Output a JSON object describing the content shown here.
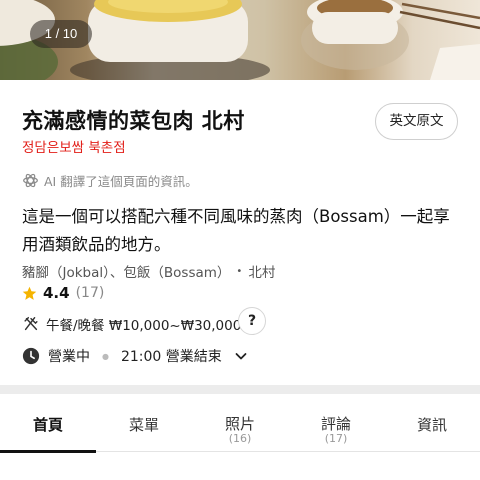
{
  "hero": {
    "photo_counter": "1 / 10"
  },
  "restaurant": {
    "name": "充滿感情的菜包肉 北村",
    "original_name": "정담은보쌈 북촌점",
    "original_language_button": "英文原文",
    "ai_note": "AI 翻譯了這個頁面的資訊。",
    "description": "這是一個可以搭配六種不同風味的蒸肉（Bossam）一起享用酒類飲品的地方。",
    "categories": "豬腳（Jokbal）、包飯（Bossam）",
    "area": "北村",
    "rating": "4.4",
    "review_count": "(17)",
    "price": "午餐/晚餐 ₩10,000~₩30,000",
    "help_label": "?",
    "status": "營業中",
    "closing": "21:00 營業結束"
  },
  "tabs": [
    {
      "label": "首頁",
      "count": "",
      "active": true
    },
    {
      "label": "菜單",
      "count": ""
    },
    {
      "label": "照片",
      "count": "(16)"
    },
    {
      "label": "評論",
      "count": "(17)"
    },
    {
      "label": "資訊",
      "count": ""
    }
  ],
  "colors": {
    "accent_red": "#e2201a",
    "star_yellow": "#f5b400",
    "active_tab_underline": "#111111"
  },
  "icons": [
    "ai-sparkle-icon",
    "star-icon",
    "cutlery-icon",
    "clock-icon",
    "chevron-down-icon"
  ]
}
